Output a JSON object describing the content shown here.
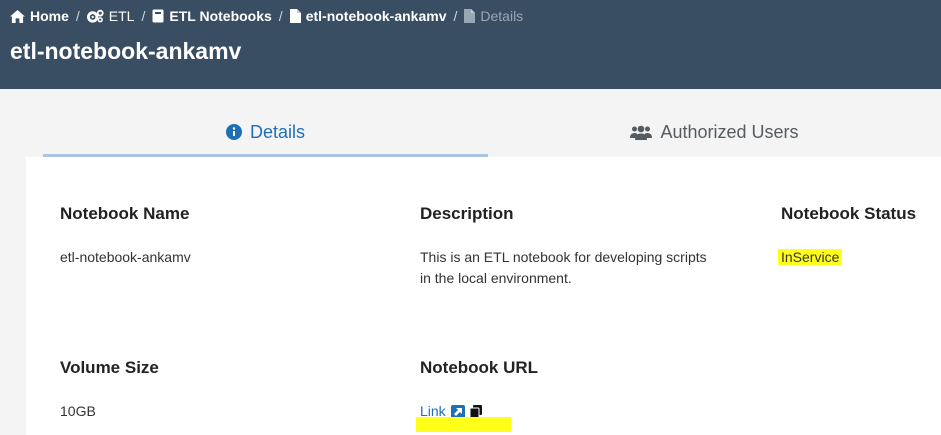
{
  "breadcrumb": {
    "home": "Home",
    "etl": "ETL",
    "notebooks": "ETL Notebooks",
    "notebook": "etl-notebook-ankamv",
    "current": "Details",
    "separator": "/"
  },
  "page_title": "etl-notebook-ankamv",
  "tabs": {
    "details": "Details",
    "authorized_users": "Authorized Users"
  },
  "fields": {
    "notebook_name": {
      "label": "Notebook Name",
      "value": "etl-notebook-ankamv"
    },
    "description": {
      "label": "Description",
      "value": "This is an ETL notebook for developing scripts in the local environment."
    },
    "notebook_status": {
      "label": "Notebook Status",
      "value": "InService"
    },
    "volume_size": {
      "label": "Volume Size",
      "value": "10GB"
    },
    "notebook_url": {
      "label": "Notebook URL",
      "link_text": "Link"
    }
  },
  "icons": {
    "home": "home-icon",
    "etl": "cogs-icon",
    "notebooks": "book-icon",
    "notebook": "file-icon",
    "details_crumb": "file-icon",
    "details_tab": "info-circle-icon",
    "users_tab": "users-icon",
    "external": "external-link-icon",
    "copy": "copy-icon"
  },
  "colors": {
    "header_bg": "#3a4e63",
    "accent": "#1f6fb5",
    "highlight": "#ffff1a"
  }
}
